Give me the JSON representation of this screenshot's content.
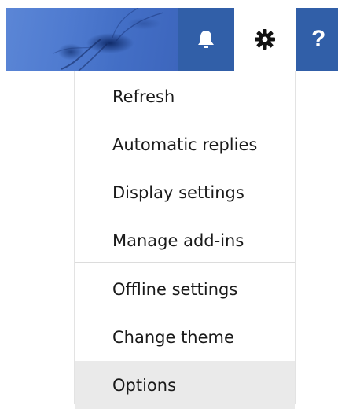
{
  "header": {
    "banner_icon": "jellyfish-theme-banner",
    "notifications_icon": "bell-icon",
    "settings_icon": "gear-icon",
    "help_label": "?"
  },
  "settings_menu": {
    "items": [
      {
        "label": "Refresh"
      },
      {
        "label": "Automatic replies"
      },
      {
        "label": "Display settings"
      },
      {
        "label": "Manage add-ins"
      },
      {
        "label": "Offline settings"
      },
      {
        "label": "Change theme"
      },
      {
        "label": "Options",
        "highlighted": true
      }
    ]
  },
  "colors": {
    "accent": "#315fa8",
    "menu_bg": "#ffffff",
    "highlight_bg": "#eaeaea",
    "text": "#1a1a1a"
  }
}
